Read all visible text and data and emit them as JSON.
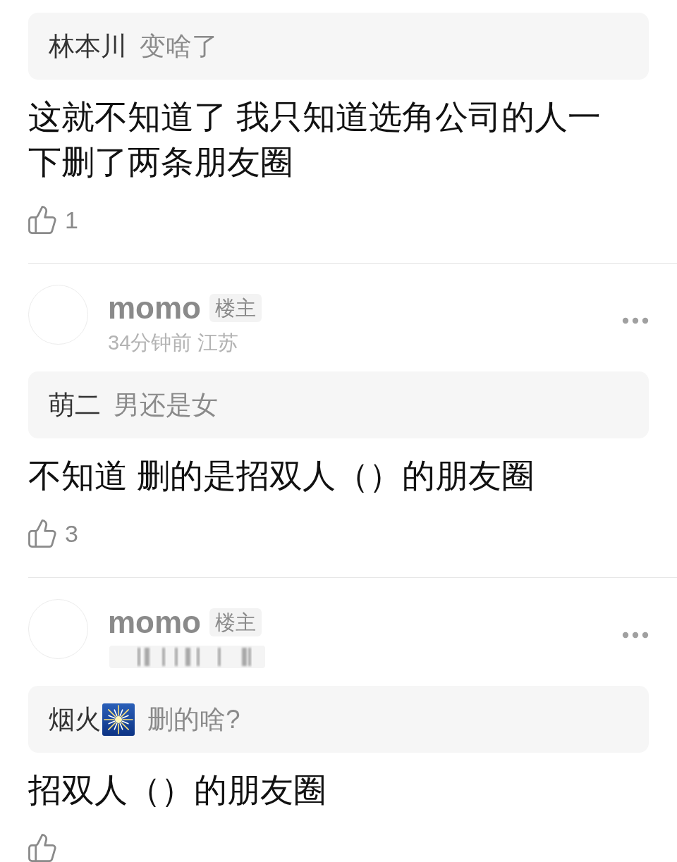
{
  "comments": [
    {
      "quote": {
        "author": "林本川",
        "text": "变啥了"
      },
      "text": "这就不知道了 我只知道选角公司的人一下删了两条朋友圈",
      "likes": "1"
    },
    {
      "author": "momo",
      "badge": "楼主",
      "meta": "34分钟前 江苏",
      "quote": {
        "author": "萌二",
        "text": "男还是女"
      },
      "text": "不知道 删的是招双人（）的朋友圈",
      "likes": "3"
    },
    {
      "author": "momo",
      "badge": "楼主",
      "meta_blurred": true,
      "quote": {
        "author": "烟火",
        "author_emoji": true,
        "text": "删的啥?"
      },
      "text": "招双人（）的朋友圈"
    }
  ]
}
